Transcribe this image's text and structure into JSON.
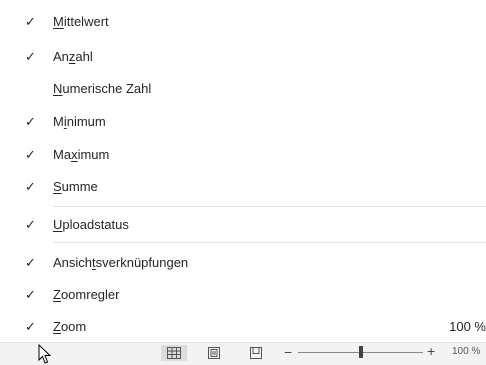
{
  "menu": {
    "items": [
      {
        "checked": true,
        "pre": "",
        "u": "M",
        "post": "ittelwert",
        "value": ""
      },
      {
        "checked": true,
        "pre": "An",
        "u": "z",
        "post": "ahl",
        "value": ""
      },
      {
        "checked": false,
        "pre": "",
        "u": "N",
        "post": "umerische Zahl",
        "value": ""
      },
      {
        "checked": true,
        "pre": "M",
        "u": "i",
        "post": "nimum",
        "value": ""
      },
      {
        "checked": true,
        "pre": "Ma",
        "u": "x",
        "post": "imum",
        "value": ""
      },
      {
        "checked": true,
        "pre": "",
        "u": "S",
        "post": "umme",
        "value": ""
      },
      {
        "checked": true,
        "pre": "",
        "u": "U",
        "post": "ploadstatus",
        "value": ""
      },
      {
        "checked": true,
        "pre": "Ansich",
        "u": "t",
        "post": "sverknüpfungen",
        "value": ""
      },
      {
        "checked": true,
        "pre": "",
        "u": "Z",
        "post": "oomregler",
        "value": ""
      },
      {
        "checked": true,
        "pre": "",
        "u": "Z",
        "post": "oom",
        "value": "100 %"
      }
    ],
    "check_glyph": "✓"
  },
  "statusbar": {
    "icons": [
      "normal-view-icon",
      "page-layout-icon",
      "page-break-preview-icon"
    ],
    "zoom_minus": "−",
    "zoom_plus": "+",
    "zoom_percent": "100 %",
    "zoom_level": 1.0
  }
}
